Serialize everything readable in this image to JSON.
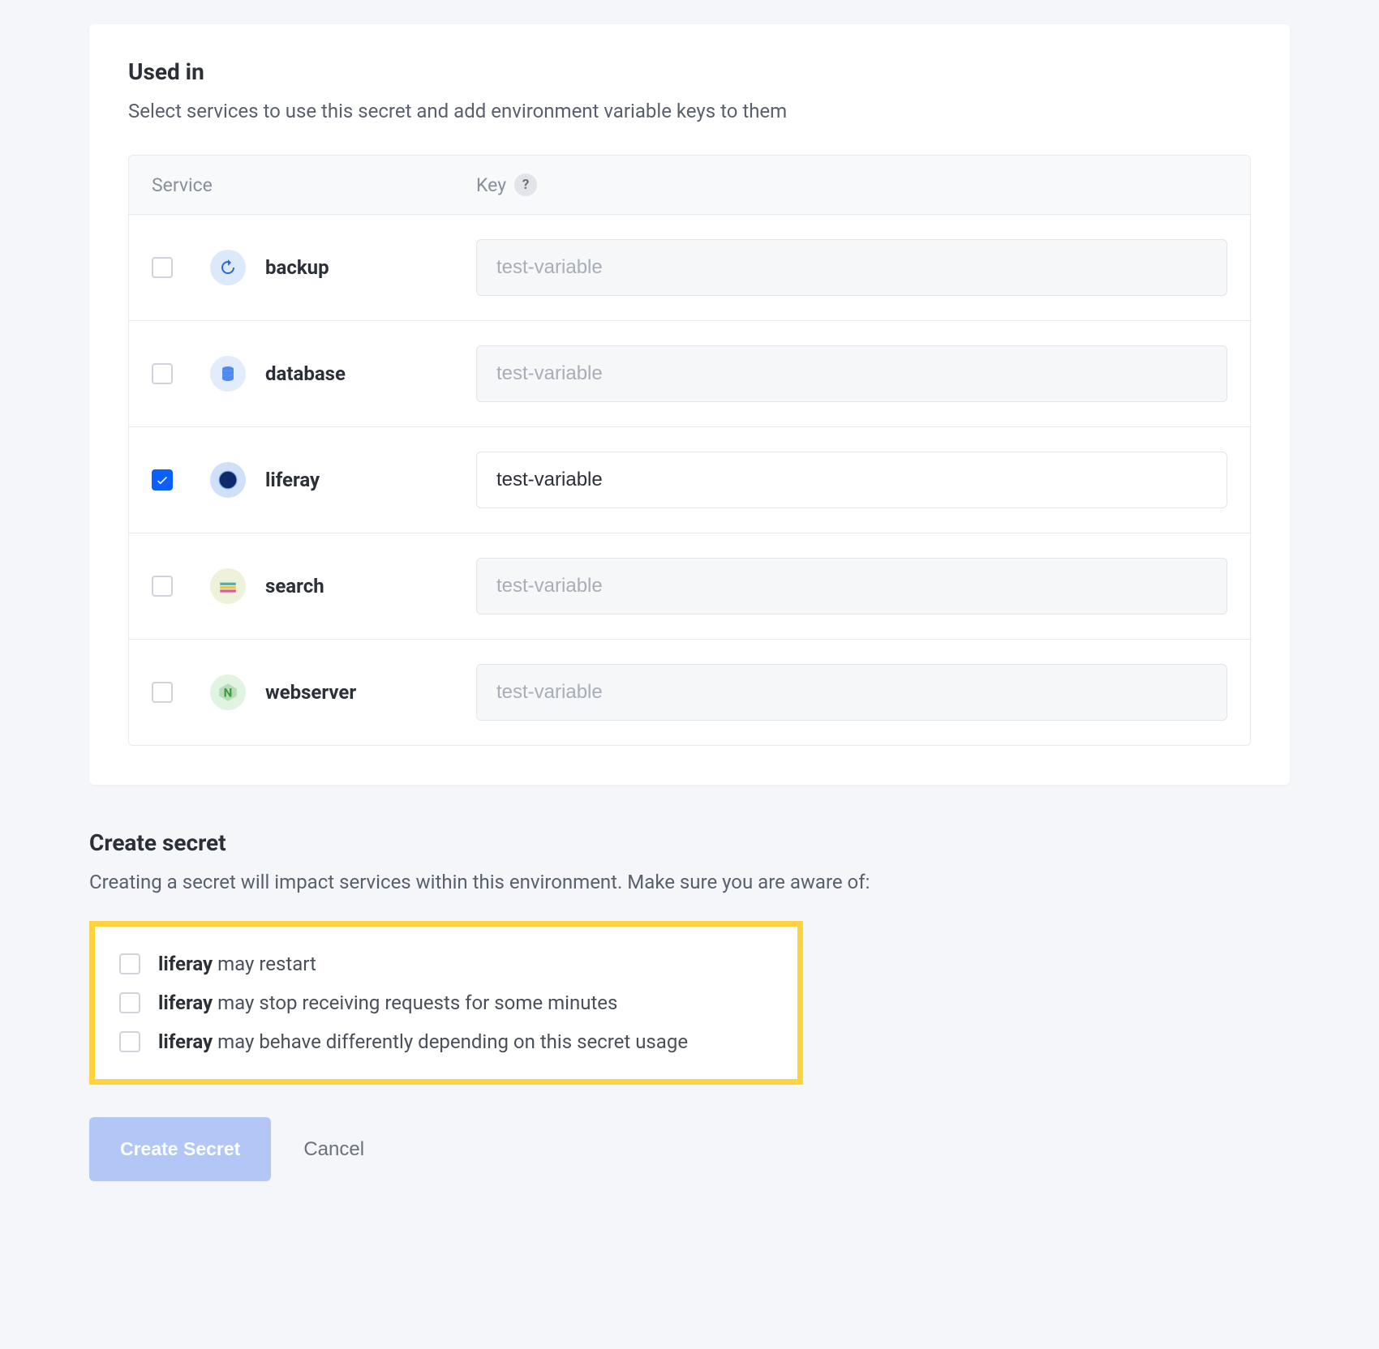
{
  "card": {
    "title": "Used in",
    "description": "Select services to use this secret and add environment variable keys to them",
    "headers": {
      "service": "Service",
      "key": "Key"
    },
    "placeholder": "test-variable",
    "services": [
      {
        "id": "backup",
        "label": "backup",
        "checked": false,
        "value": "",
        "iconClass": "ic-backup"
      },
      {
        "id": "database",
        "label": "database",
        "checked": false,
        "value": "",
        "iconClass": "ic-database"
      },
      {
        "id": "liferay",
        "label": "liferay",
        "checked": true,
        "value": "test-variable",
        "iconClass": "ic-liferay"
      },
      {
        "id": "search",
        "label": "search",
        "checked": false,
        "value": "",
        "iconClass": "ic-search"
      },
      {
        "id": "webserver",
        "label": "webserver",
        "checked": false,
        "value": "",
        "iconClass": "ic-webserver"
      }
    ]
  },
  "create": {
    "title": "Create secret",
    "description": "Creating a secret will impact services within this environment. Make sure you are aware of:",
    "warnings": [
      {
        "service": "liferay",
        "text": " may restart"
      },
      {
        "service": "liferay",
        "text": " may stop receiving requests for some minutes"
      },
      {
        "service": "liferay",
        "text": " may behave differently depending on this secret usage"
      }
    ],
    "primary": "Create Secret",
    "cancel": "Cancel"
  }
}
